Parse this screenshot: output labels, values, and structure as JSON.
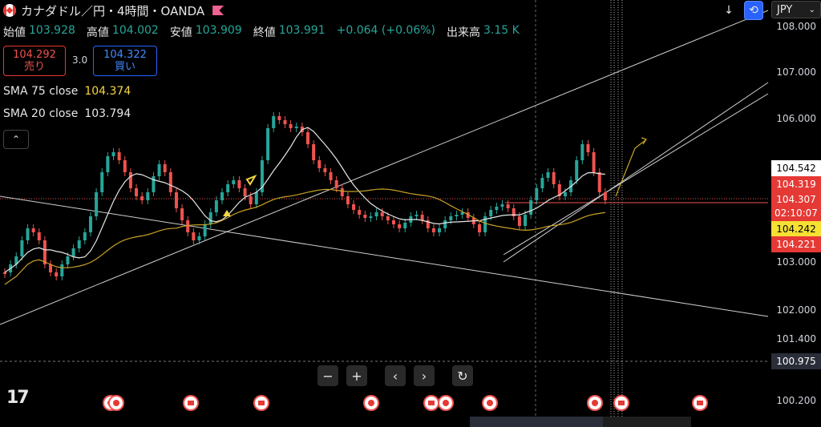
{
  "header": {
    "title": "カナダドル／円・4時間・OANDA"
  },
  "ohlc": {
    "open_label": "始値",
    "open": "103.928",
    "high_label": "高値",
    "high": "104.002",
    "low_label": "安値",
    "low": "103.909",
    "close_label": "終値",
    "close": "103.991",
    "change": "+0.064 (+0.06%)",
    "volume_label": "出来高",
    "volume": "3.15 K"
  },
  "trade": {
    "sell_price": "104.292",
    "sell_label": "売り",
    "spread": "3.0",
    "buy_price": "104.322",
    "buy_label": "買い"
  },
  "indicators": [
    {
      "name": "SMA 75 close",
      "value": "104.374",
      "color": "#f5d742"
    },
    {
      "name": "SMA 20 close",
      "value": "103.794",
      "color": "#e6e6e6"
    }
  ],
  "toolbar": {
    "currency": "JPY",
    "download_icon": "down-arrow-icon",
    "sync_icon": "sync-icon"
  },
  "price_axis": {
    "labels": [
      "108.000",
      "107.000",
      "106.000",
      "103.000",
      "102.000",
      "101.400",
      "100.200"
    ],
    "tags": {
      "current_white": "104.542",
      "sell": "104.319",
      "last": "104.307",
      "countdown": "02:10:07",
      "sma75": "104.242",
      "sma20_tag": "104.221",
      "crosshair": "100.975"
    }
  },
  "colors": {
    "up": "#26a69a",
    "down": "#ef5350",
    "sma20": "#e6e6e6",
    "sma75": "#d4b106",
    "accent_blue": "#2962ff"
  },
  "zoom_controls": [
    "−",
    "+",
    "‹",
    "›",
    "↻"
  ],
  "events_count": 12
}
